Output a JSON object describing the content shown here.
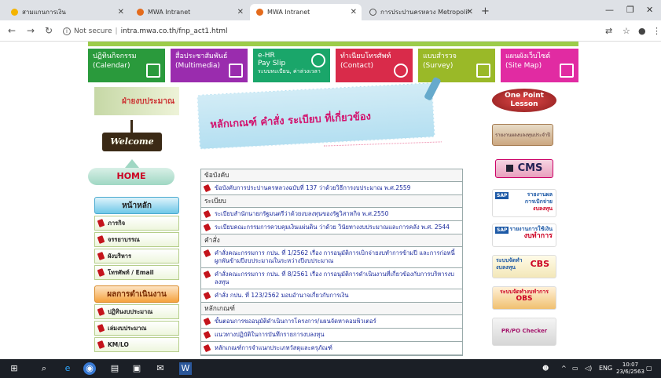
{
  "browser": {
    "tabs": [
      {
        "label": "สามแกนการเงิน",
        "active": false
      },
      {
        "label": "MWA Intranet",
        "active": false
      },
      {
        "label": "MWA Intranet",
        "active": true
      },
      {
        "label": "การประปานครหลวง Metropolitan W",
        "active": false
      }
    ],
    "security": "Not secure",
    "url": "intra.mwa.co.th/fnp_act1.html"
  },
  "top_menu": [
    {
      "line1": "ปฏิทินกิจกรรม",
      "line2": "(Calendar)",
      "color": "#2a9a3c"
    },
    {
      "line1": "สื่อประชาสัมพันธ์",
      "line2": "(Multimedia)",
      "color": "#9a2cae"
    },
    {
      "line1": "e-HR",
      "line2": "Pay Slip",
      "line3": "ระบบทะเบียน, ค่าล่วงเวลา",
      "color": "#1aa66a"
    },
    {
      "line1": "ทำเนียบโทรศัพท์",
      "line2": "(Contact)",
      "color": "#d92b4a"
    },
    {
      "line1": "แบบสำรวจ",
      "line2": "(Survey)",
      "color": "#9ab928"
    },
    {
      "line1": "แผนผังเว็บไซต์",
      "line2": "(Site Map)",
      "color": "#e12ba2"
    }
  ],
  "left": {
    "banner": "ฝ่ายงบประมาณ",
    "welcome": "Welcome",
    "home": "HOME",
    "main_header": "หน้าหลัก",
    "main_items": [
      "ภารกิจ",
      "จรรยาบรรณ",
      "ผังบริหาร",
      "โทรศัพท์ / Email"
    ],
    "perf_header": "ผลการดำเนินงาน",
    "perf_items": [
      "ปฏิทินงบประมาณ",
      "เล่มงบประมาณ",
      "KM/LO"
    ]
  },
  "center": {
    "title": "หลักเกณฑ์ คำสั่ง ระเบียบ ที่เกี่ยวข้อง",
    "sections": [
      {
        "heading": "ข้อบังคับ",
        "items": [
          "ข้อบังคับการประปานครหลวงฉบับที่ 137 ว่าด้วยวิธีการงบประมาณ พ.ศ.2559"
        ]
      },
      {
        "heading": "ระเบียบ",
        "items": [
          "ระเบียบสำนักนายกรัฐมนตรีว่าด้วยงบลงทุนของรัฐวิสาหกิจ พ.ศ.2550",
          "ระเบียบคณะกรรมการควบคุมเงินแผ่นดิน ว่าด้วย วินัยทางงบประมาณและการคลัง พ.ศ. 2544"
        ]
      },
      {
        "heading": "คำสั่ง",
        "items": [
          "คำสั่งคณะกรรมการ กปน. ที่ 1/2562 เรื่อง การอนุมัติการเบิกจ่ายงบทำการข้ามปี และการก่อหนี้ผูกพันข้ามปีงบประมาณในระหว่างปีงบประมาณ",
          "คำสั่งคณะกรรมการ กปน. ที่ 8/2561 เรื่อง การอนุมัติการดำเนินงานที่เกี่ยวข้องกับการบริหารงบลงทุน",
          "คำสั่ง กปน. ที่ 123/2562 มอบอำนาจเกี่ยวกับการเงิน"
        ]
      },
      {
        "heading": "หลักเกณฑ์",
        "items": [
          "ขั้นตอนการขออนุมัติดำเนินการโครงการ/แผนจัดหาคอมพิวเตอร์",
          "แนวทางปฏิบัติในการบันทึกรายการงบลงทุน",
          "หลักเกณฑ์การจำแนกประเภทวัสดุและครุภัณฑ์"
        ]
      }
    ]
  },
  "right": {
    "onepoint_1": "One Point",
    "onepoint_2": "Lesson",
    "report": "รายงานผลงบลงทุนประจำปี",
    "cms": "CMS",
    "sap1_tag": "SAP",
    "sap1_l1": "รายงานผล",
    "sap1_l2": "การเบิกจ่าย",
    "sap1_l3": "งบลงทุน",
    "sap2_tag": "SAP",
    "sap2_l1": "รายงานการใช้เงิน",
    "sap2_l2": "งบทำการ",
    "cbs_l1": "ระบบจัดทำ",
    "cbs_l2": "งบลงทุน",
    "cbs_l3": "CBS",
    "cbs2_l1": "ระบบจัดทำงบทำการ",
    "cbs2_l2": "OBS",
    "checker": "PR/PO Checker"
  },
  "taskbar": {
    "lang": "ENG",
    "time": "10:07",
    "date": "23/6/2563"
  }
}
